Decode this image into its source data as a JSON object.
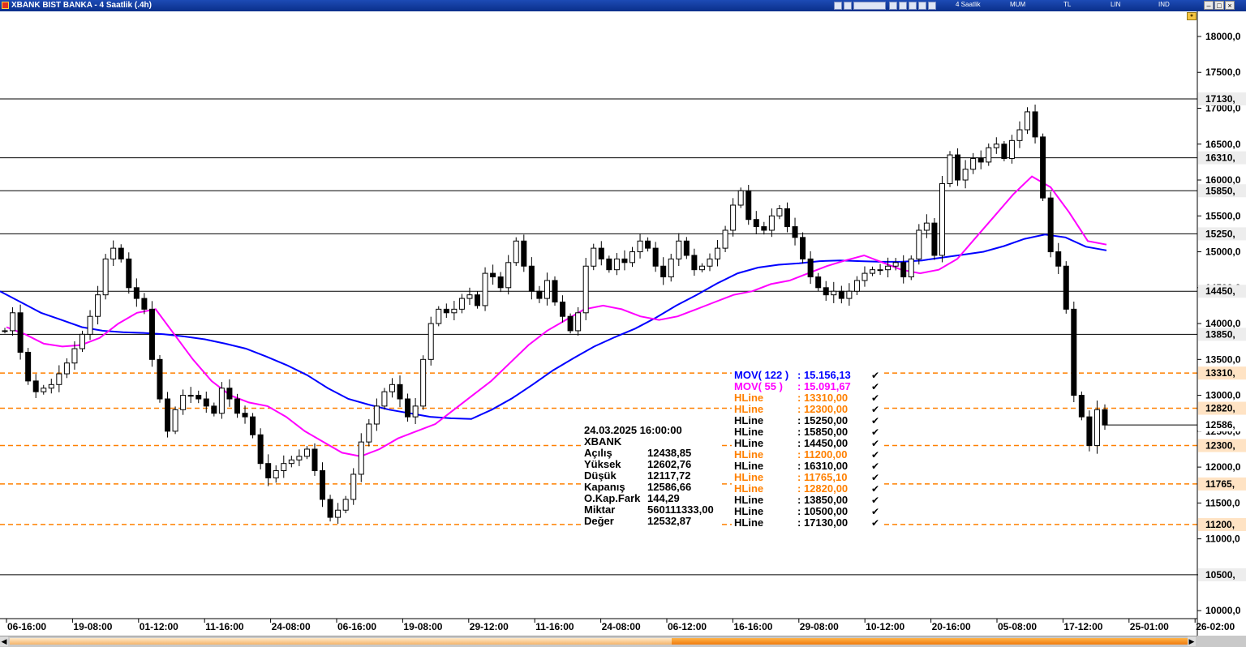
{
  "window": {
    "title": "XBANK BIST BANKA - 4 Saatlik (.4h)",
    "toolbar_words": [
      "4 Saatlik",
      "MUM",
      "TL",
      "LIN",
      "IND"
    ],
    "icons": [
      "app-icon",
      "toolbar-icons",
      "lock-icon",
      "minimize-icon",
      "restore-icon",
      "close-icon"
    ]
  },
  "colors": {
    "mov122": "#0000ff",
    "mov55": "#ff00ff",
    "hline_orange": "#ff8000",
    "hline_black": "#000000",
    "candle": "#000000"
  },
  "chart_data": {
    "type": "candlestick",
    "symbol": "XBANK",
    "timeframe": "4 Saatlik",
    "ylim": [
      9900,
      18350
    ],
    "y_ticks": [
      "10000,0",
      "10500,0",
      "11000,0",
      "11500,0",
      "12000,0",
      "12500,0",
      "13000,0",
      "13500,0",
      "14000,0",
      "14500,0",
      "15000,0",
      "15500,0",
      "16000,0",
      "16500,0",
      "17000,0",
      "17500,0",
      "18000,0"
    ],
    "x_ticks": [
      "06-16:00",
      "19-08:00",
      "01-12:00",
      "11-16:00",
      "24-08:00",
      "06-16:00",
      "19-08:00",
      "29-12:00",
      "11-16:00",
      "24-08:00",
      "06-12:00",
      "16-16:00",
      "29-08:00",
      "10-12:00",
      "20-16:00",
      "05-08:00",
      "17-12:00",
      "25-01:00",
      "26-02:00"
    ],
    "hlines_black": [
      10500,
      13850,
      14450,
      15250,
      15850,
      16310,
      17130
    ],
    "hlines_orange": [
      11200,
      11765.1,
      12300,
      12820,
      13310
    ],
    "price_tags": [
      {
        "label": "17130,",
        "value": 17130,
        "style": "black"
      },
      {
        "label": "16310,",
        "value": 16310,
        "style": "black"
      },
      {
        "label": "15850,",
        "value": 15850,
        "style": "black"
      },
      {
        "label": "15250,",
        "value": 15250,
        "style": "black"
      },
      {
        "label": "14450,",
        "value": 14450,
        "style": "black"
      },
      {
        "label": "13850,",
        "value": 13850,
        "style": "black"
      },
      {
        "label": "13310,",
        "value": 13310,
        "style": "orange"
      },
      {
        "label": "12820,",
        "value": 12820,
        "style": "orange"
      },
      {
        "label": "12586,",
        "value": 12586.66,
        "style": "last"
      },
      {
        "label": "12300,",
        "value": 12300,
        "style": "orange"
      },
      {
        "label": "11765,",
        "value": 11765.1,
        "style": "orange"
      },
      {
        "label": "11200,",
        "value": 11200,
        "style": "orange"
      },
      {
        "label": "10500,",
        "value": 10500,
        "style": "black"
      }
    ],
    "close_path": [
      13900,
      14150,
      13600,
      13200,
      13050,
      13100,
      13150,
      13300,
      13450,
      13650,
      13850,
      14100,
      14400,
      14900,
      15050,
      14900,
      14500,
      14350,
      14200,
      13500,
      12950,
      12500,
      12800,
      13000,
      13000,
      12950,
      12850,
      12750,
      13100,
      12950,
      12750,
      12700,
      12450,
      12050,
      11850,
      11950,
      12050,
      12100,
      12150,
      12250,
      11950,
      11550,
      11300,
      11400,
      11550,
      11900,
      12350,
      12600,
      12850,
      13050,
      13150,
      12950,
      12700,
      12850,
      13500,
      14000,
      14200,
      14150,
      14200,
      14350,
      14400,
      14250,
      14700,
      14650,
      14500,
      14850,
      15150,
      14800,
      14450,
      14350,
      14600,
      14300,
      14100,
      13900,
      14150,
      14800,
      15050,
      14900,
      14750,
      14900,
      14850,
      15000,
      15150,
      15050,
      14800,
      14650,
      14900,
      15150,
      14950,
      14750,
      14800,
      14900,
      15050,
      15300,
      15650,
      15850,
      15450,
      15350,
      15300,
      15500,
      15600,
      15350,
      15200,
      14900,
      14650,
      14500,
      14400,
      14450,
      14350,
      14450,
      14600,
      14700,
      14750,
      14750,
      14800,
      14850,
      14650,
      14900,
      15300,
      15400,
      14950,
      15950,
      16350,
      16000,
      16150,
      16300,
      16250,
      16450,
      16500,
      16300,
      16550,
      16700,
      16950,
      16600,
      15750,
      15000,
      14800,
      14200,
      13000,
      12700,
      12300,
      12800,
      12586.66
    ],
    "mov122_path": [
      14450,
      14300,
      14150,
      14050,
      13950,
      13900,
      13880,
      13870,
      13850,
      13820,
      13780,
      13720,
      13650,
      13540,
      13420,
      13280,
      13100,
      12950,
      12870,
      12800,
      12750,
      12700,
      12680,
      12670,
      12800,
      12960,
      13150,
      13350,
      13520,
      13680,
      13810,
      13930,
      14080,
      14250,
      14400,
      14560,
      14700,
      14780,
      14820,
      14840,
      14870,
      14880,
      14870,
      14860,
      14860,
      14880,
      14920,
      14960,
      15000,
      15080,
      15180,
      15240,
      15200,
      15070,
      15020
    ],
    "mov55_path": [
      13950,
      13850,
      13720,
      13680,
      13700,
      13800,
      14000,
      14150,
      14200,
      13850,
      13500,
      13200,
      13000,
      12900,
      12850,
      12700,
      12500,
      12350,
      12200,
      12150,
      12250,
      12400,
      12500,
      12600,
      12800,
      13000,
      13200,
      13450,
      13700,
      13900,
      14050,
      14200,
      14250,
      14200,
      14100,
      14050,
      14100,
      14200,
      14300,
      14400,
      14450,
      14550,
      14600,
      14700,
      14800,
      14880,
      14950,
      14850,
      14750,
      14700,
      14750,
      14900,
      15200,
      15500,
      15800,
      16050,
      15900,
      15550,
      15150,
      15100
    ],
    "legend": [
      {
        "label": "MOV( 122 )",
        "value": ": 15.156,13",
        "style": "blue"
      },
      {
        "label": "MOV( 55 )",
        "value": ": 15.091,67",
        "style": "magenta"
      },
      {
        "label": "HLine",
        "value": ": 13310,00",
        "style": "orange"
      },
      {
        "label": "HLine",
        "value": ": 12300,00",
        "style": "orange"
      },
      {
        "label": "HLine",
        "value": ": 15250,00",
        "style": "black"
      },
      {
        "label": "HLine",
        "value": ": 15850,00",
        "style": "black"
      },
      {
        "label": "HLine",
        "value": ": 14450,00",
        "style": "black"
      },
      {
        "label": "HLine",
        "value": ": 11200,00",
        "style": "orange"
      },
      {
        "label": "HLine",
        "value": ": 16310,00",
        "style": "black"
      },
      {
        "label": "HLine",
        "value": ": 11765,10",
        "style": "orange"
      },
      {
        "label": "HLine",
        "value": ": 12820,00",
        "style": "orange"
      },
      {
        "label": "HLine",
        "value": ": 13850,00",
        "style": "black"
      },
      {
        "label": "HLine",
        "value": ": 10500,00",
        "style": "black"
      },
      {
        "label": "HLine",
        "value": ": 17130,00",
        "style": "black"
      }
    ],
    "info_box": {
      "datetime": "24.03.2025  16:00:00",
      "symbol": "XBANK",
      "rows": [
        {
          "label": "Açılış",
          "value": "12438,85"
        },
        {
          "label": "Yüksek",
          "value": "12602,76"
        },
        {
          "label": "Düşük",
          "value": "12117,72"
        },
        {
          "label": "Kapanış",
          "value": "12586,66"
        },
        {
          "label": "O.Kap.Fark",
          "value": "144,29"
        },
        {
          "label": "Miktar",
          "value": "560111333,00"
        },
        {
          "label": "Değer",
          "value": "12532,87"
        }
      ]
    }
  }
}
